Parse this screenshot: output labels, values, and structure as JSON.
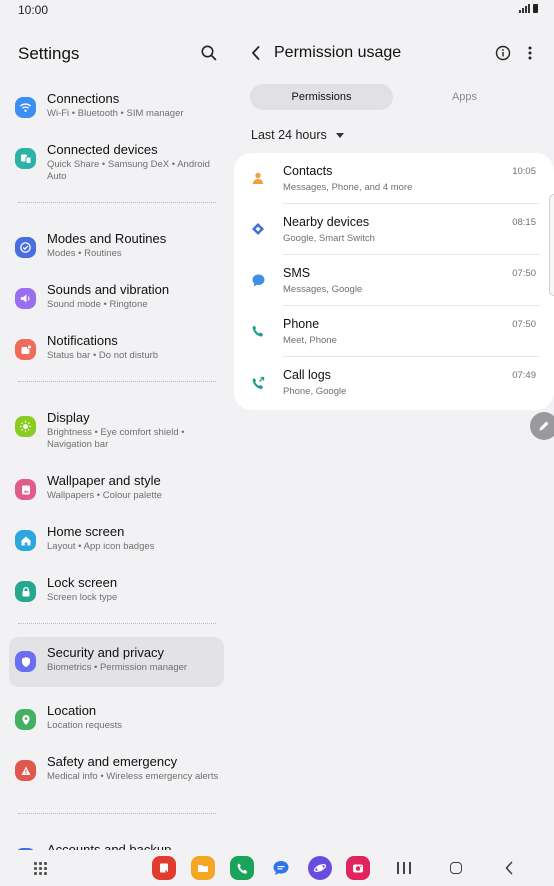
{
  "status_bar": {
    "time": "10:00"
  },
  "settings": {
    "title": "Settings",
    "items": [
      {
        "title": "Connections",
        "subtitle": "Wi-Fi  •  Bluetooth  •  SIM manager",
        "icon": "wifi-icon",
        "color": "#3c8ef0"
      },
      {
        "title": "Connected devices",
        "subtitle": "Quick Share  •  Samsung DeX  •  Android Auto",
        "icon": "connected-devices-icon",
        "color": "#2cb3a6"
      },
      {
        "title": "Modes and Routines",
        "subtitle": "Modes  •  Routines",
        "icon": "check-circle-icon",
        "color": "#4a6ee0"
      },
      {
        "title": "Sounds and vibration",
        "subtitle": "Sound mode  •  Ringtone",
        "icon": "speaker-icon",
        "color": "#9b6ef0"
      },
      {
        "title": "Notifications",
        "subtitle": "Status bar  •  Do not disturb",
        "icon": "notification-icon",
        "color": "#ef6b5a"
      },
      {
        "title": "Display",
        "subtitle": "Brightness  •  Eye comfort shield  •  Navigation bar",
        "icon": "sun-icon",
        "color": "#8acc22"
      },
      {
        "title": "Wallpaper and style",
        "subtitle": "Wallpapers  •  Colour palette",
        "icon": "wallpaper-icon",
        "color": "#e05c8a"
      },
      {
        "title": "Home screen",
        "subtitle": "Layout  •  App icon badges",
        "icon": "home-icon",
        "color": "#2aa6e0"
      },
      {
        "title": "Lock screen",
        "subtitle": "Screen lock type",
        "icon": "lock-icon",
        "color": "#25a88f"
      },
      {
        "title": "Security and privacy",
        "subtitle": "Biometrics  •  Permission manager",
        "icon": "shield-icon",
        "color": "#6a6ef0"
      },
      {
        "title": "Location",
        "subtitle": "Location requests",
        "icon": "location-icon",
        "color": "#46b062"
      },
      {
        "title": "Safety and emergency",
        "subtitle": "Medical info  •  Wireless emergency alerts",
        "icon": "emergency-icon",
        "color": "#e0574e"
      },
      {
        "title": "Accounts and backup",
        "subtitle": "",
        "icon": "accounts-icon",
        "color": "#3f6fe0"
      }
    ]
  },
  "permission_usage": {
    "title": "Permission usage",
    "tabs": [
      "Permissions",
      "Apps"
    ],
    "time_range": "Last 24 hours",
    "rows": [
      {
        "title": "Contacts",
        "subtitle": "Messages, Phone, and 4 more",
        "time": "10:05",
        "icon": "contacts-icon",
        "color": "#f0a040"
      },
      {
        "title": "Nearby devices",
        "subtitle": "Google, Smart Switch",
        "time": "08:15",
        "icon": "nearby-devices-icon",
        "color": "#3f6fd8"
      },
      {
        "title": "SMS",
        "subtitle": "Messages, Google",
        "time": "07:50",
        "icon": "sms-icon",
        "color": "#3f8fe8"
      },
      {
        "title": "Phone",
        "subtitle": "Meet, Phone",
        "time": "07:50",
        "icon": "phone-icon",
        "color": "#1f9e8a"
      },
      {
        "title": "Call logs",
        "subtitle": "Phone, Google",
        "time": "07:49",
        "icon": "call-log-icon",
        "color": "#1f9e8a"
      }
    ]
  },
  "dock": {
    "apps": [
      {
        "icon": "notes-app-icon",
        "color": "#e03b2e"
      },
      {
        "icon": "files-app-icon",
        "color": "#f5a623"
      },
      {
        "icon": "phone-app-icon",
        "color": "#1aa35a"
      },
      {
        "icon": "messages-app-icon",
        "color": "#2f73e8"
      },
      {
        "icon": "internet-app-icon",
        "color": "#6a4de0"
      },
      {
        "icon": "camera-app-icon",
        "color": "#e0245e"
      }
    ]
  }
}
